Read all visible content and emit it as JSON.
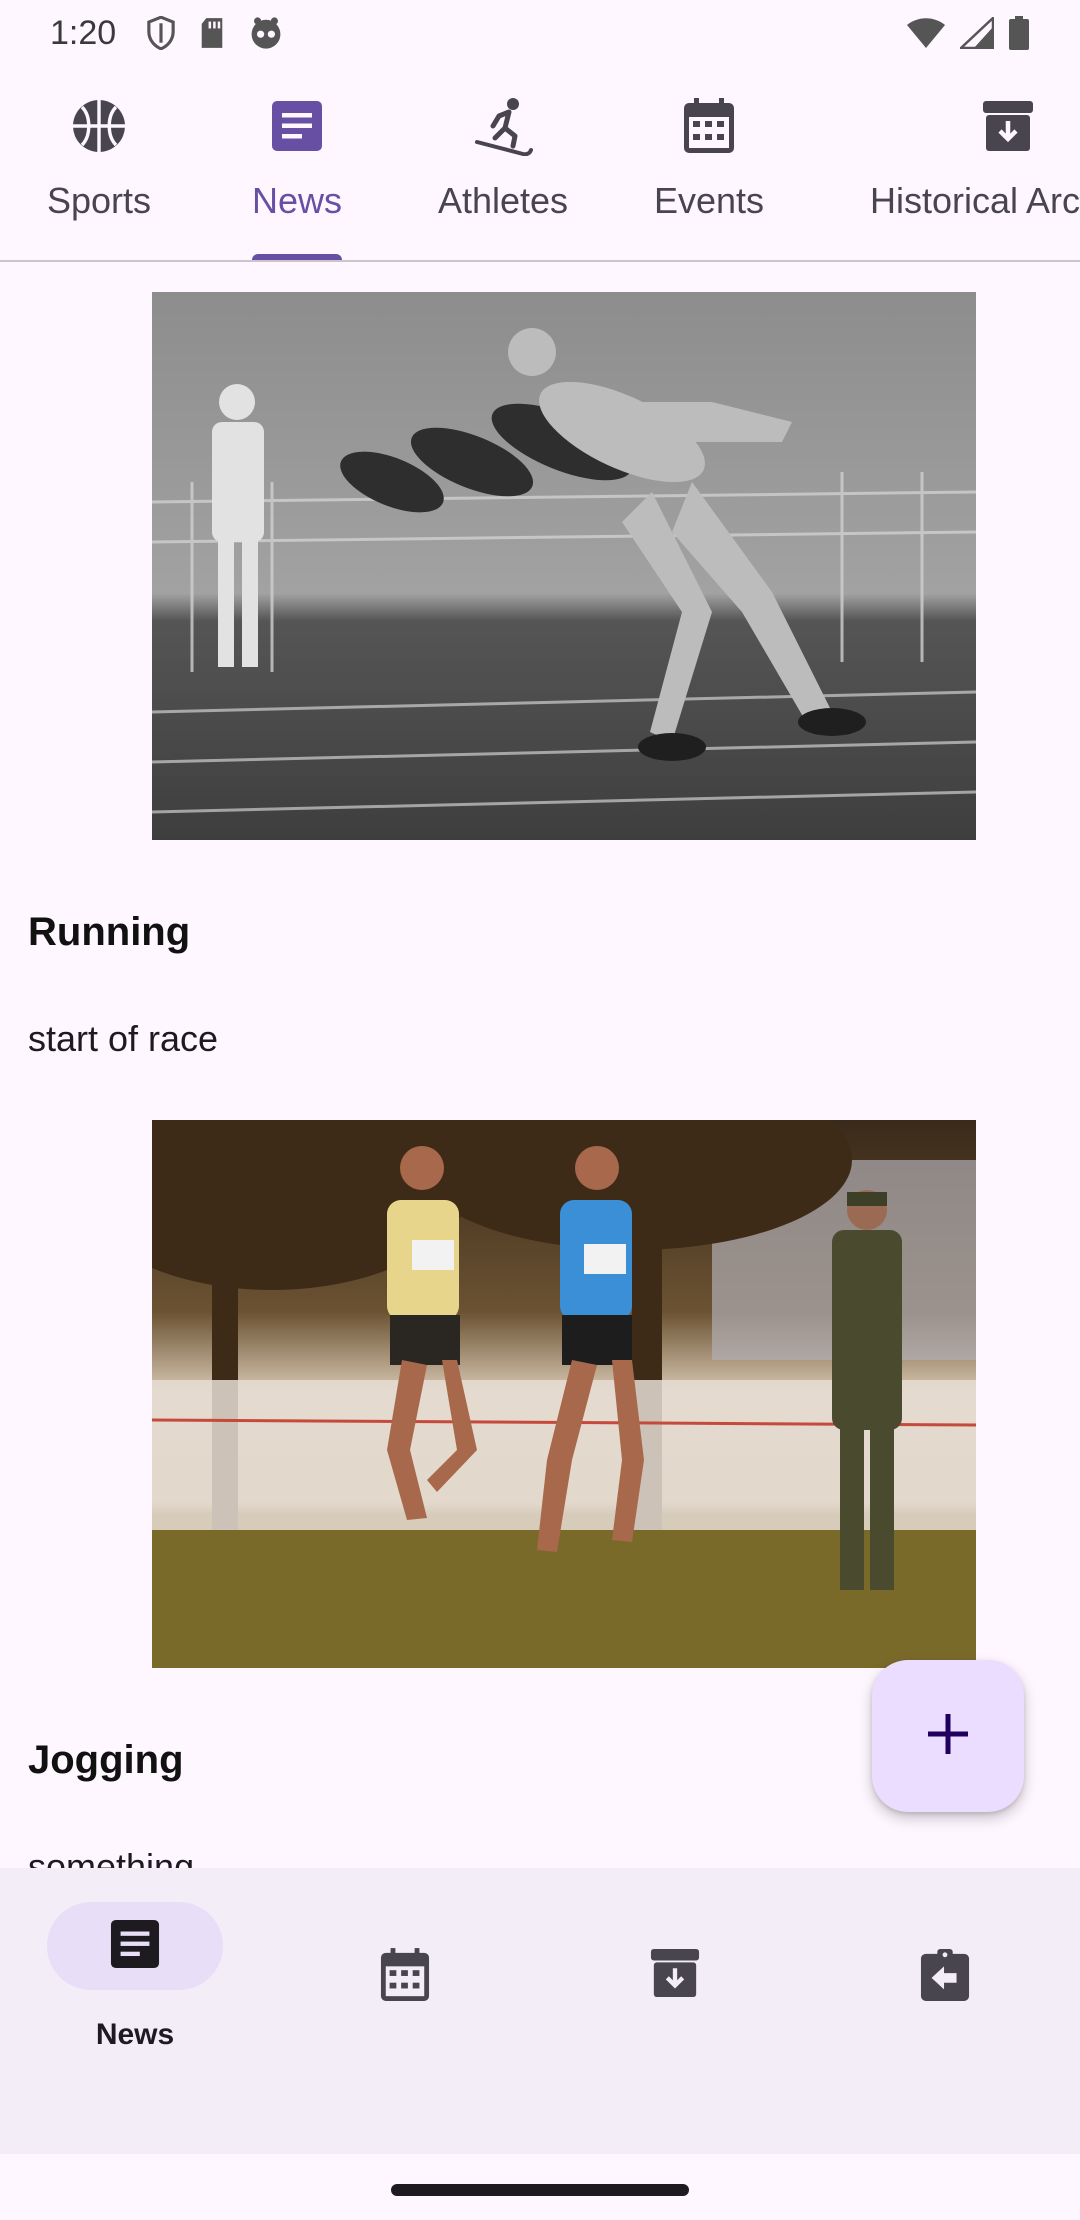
{
  "status_bar": {
    "time": "1:20"
  },
  "top_tabs": [
    {
      "label": "Sports",
      "icon": "basketball-icon",
      "active": false
    },
    {
      "label": "News",
      "icon": "article-icon",
      "active": true
    },
    {
      "label": "Athletes",
      "icon": "skier-icon",
      "active": false
    },
    {
      "label": "Events",
      "icon": "calendar-icon",
      "active": false
    },
    {
      "label": "Historical Archive",
      "icon": "archive-icon",
      "active": false
    }
  ],
  "news": [
    {
      "title": "Running",
      "description": "start of race",
      "image": "sprinters-starting-race-photo"
    },
    {
      "title": "Jogging",
      "description": "something",
      "image": "runners-cross-country-photo"
    }
  ],
  "fab": {
    "icon": "plus-icon"
  },
  "bottom_nav": [
    {
      "label": "News",
      "icon": "article-icon",
      "active": true
    },
    {
      "label": "",
      "icon": "calendar-icon",
      "active": false
    },
    {
      "label": "",
      "icon": "archive-icon",
      "active": false
    },
    {
      "label": "",
      "icon": "assignment-return-icon",
      "active": false
    }
  ],
  "colors": {
    "primary": "#6750A4",
    "surface": "#FEF7FF",
    "nav_background": "#F3EDF7",
    "fab_background": "#EADDFF",
    "indicator_pill": "#E8DEF8"
  }
}
